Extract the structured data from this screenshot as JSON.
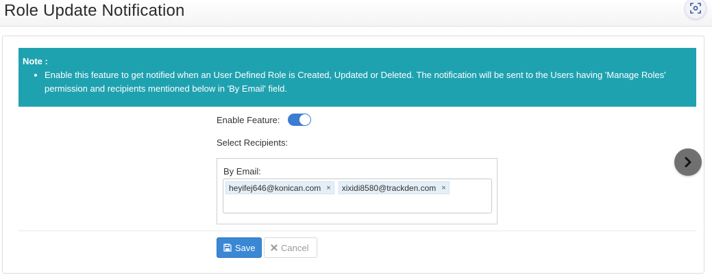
{
  "page": {
    "title": "Role Update Notification"
  },
  "note": {
    "title": "Note :",
    "text": "Enable this feature to get notified when an User Defined Role is Created, Updated or Deleted. The notification will be sent to the Users having 'Manage Roles' permission and recipients mentioned below in 'By Email' field."
  },
  "form": {
    "enable_label": "Enable Feature:",
    "enable_on": true,
    "recipients_label": "Select Recipients:",
    "by_email_label": "By Email:",
    "emails": [
      "heyifej646@konican.com",
      "xixidi8580@trackden.com"
    ],
    "remove_glyph": "×"
  },
  "actions": {
    "save_label": "Save",
    "cancel_label": "Cancel"
  },
  "colors": {
    "note_bg": "#1fa2b0",
    "accent": "#3a87d4",
    "next_button": "#707070"
  },
  "icons": {
    "screenshot": "screenshot-icon",
    "next": "chevron-right-icon",
    "save": "floppy-disk-icon",
    "cancel": "close-icon"
  }
}
